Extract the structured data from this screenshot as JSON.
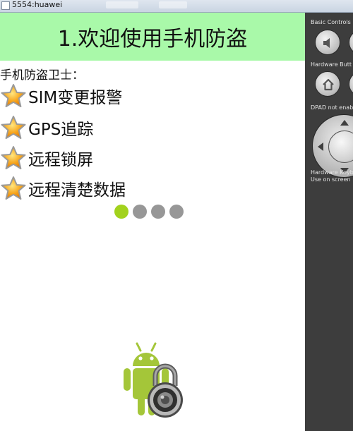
{
  "window": {
    "title": "5554:huawei"
  },
  "app": {
    "header_title": "1.欢迎使用手机防盗",
    "subtitle": "手机防盗卫士：",
    "features": [
      {
        "label": "SIM变更报警",
        "icon": "star-icon"
      },
      {
        "label": "GPS追踪",
        "icon": "star-icon"
      },
      {
        "label": "远程锁屏",
        "icon": "star-icon"
      },
      {
        "label": "远程清楚数据",
        "icon": "star-icon"
      }
    ],
    "pager": {
      "total": 4,
      "active": 1
    },
    "illustration": "android-lock-icon",
    "colors": {
      "header_bg": "#a9f9a9",
      "dot_active": "#a2d21d",
      "dot_inactive": "#979797",
      "android_green": "#a4c639"
    }
  },
  "emulator_panel": {
    "basic_controls_label": "Basic Controls",
    "hardware_buttons_label": "Hardware Butt",
    "dpad_label": "DPAD not enab",
    "keyboard_label": "Hardware Keyb",
    "keyboard_sub": "Use on screen"
  }
}
